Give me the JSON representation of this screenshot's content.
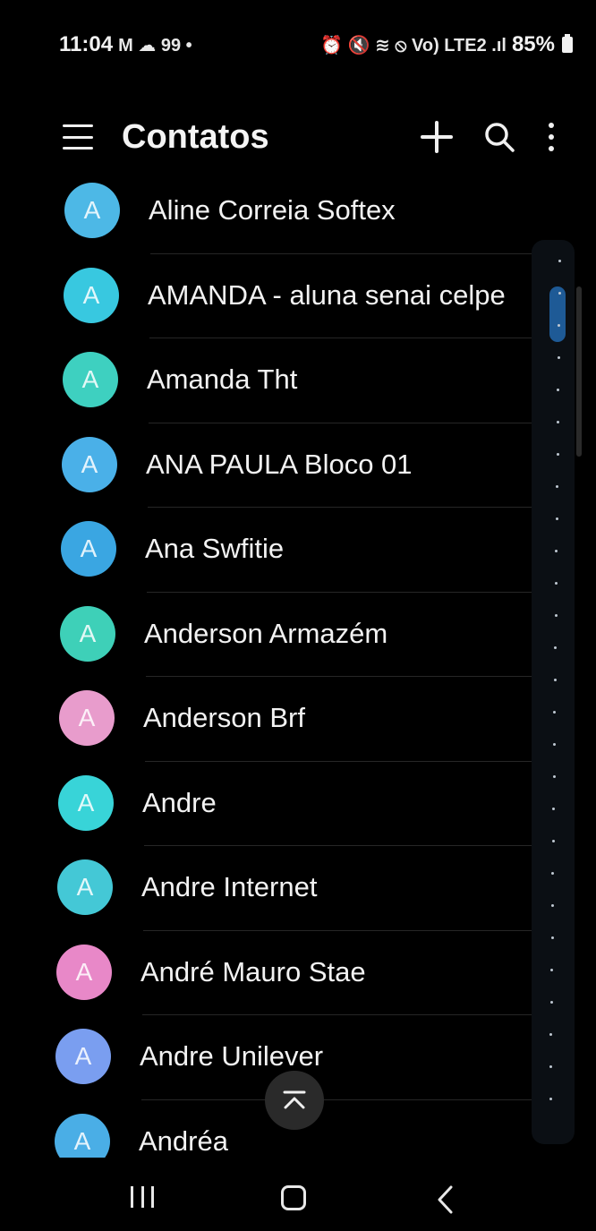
{
  "status_bar": {
    "time": "11:04",
    "left_icons": "M ☁ 99 •",
    "right_icons": "⏰ 🔇 ≋ ⦸ Vo) LTE2 .ıl",
    "battery": "85%"
  },
  "app_bar": {
    "title": "Contatos",
    "menu_icon": "hamburger-menu-icon",
    "add_icon": "plus-icon",
    "search_icon": "search-icon",
    "more_icon": "more-vertical-icon"
  },
  "contacts": [
    {
      "initial": "A",
      "name": "Aline Correia Softex",
      "color": "#4db8e6"
    },
    {
      "initial": "A",
      "name": "AMANDA - aluna senai celpe",
      "color": "#38c8e0"
    },
    {
      "initial": "A",
      "name": "Amanda Tht",
      "color": "#3ed0c0"
    },
    {
      "initial": "A",
      "name": "ANA PAULA Bloco 01",
      "color": "#4ab0e8"
    },
    {
      "initial": "A",
      "name": "Ana Swfitie",
      "color": "#3aa6e2"
    },
    {
      "initial": "A",
      "name": "Anderson Armazém",
      "color": "#3ed0b8"
    },
    {
      "initial": "A",
      "name": "Anderson Brf",
      "color": "#e89ccc"
    },
    {
      "initial": "A",
      "name": "Andre",
      "color": "#38d4d8"
    },
    {
      "initial": "A",
      "name": "Andre Internet",
      "color": "#44c8d6"
    },
    {
      "initial": "A",
      "name": "André Mauro Stae",
      "color": "#e888c8"
    },
    {
      "initial": "A",
      "name": "Andre Unilever",
      "color": "#7a9ef0"
    },
    {
      "initial": "A",
      "name": "Andréa",
      "color": "#4aaee6"
    }
  ],
  "colors": {
    "background": "#000000",
    "text": "#f2f2f2",
    "index_thumb": "#1e5a96"
  },
  "scroll_top_icon": "chevron-up-double-icon",
  "nav_bar": {
    "recent_icon": "recent-apps-icon",
    "home_icon": "home-icon",
    "back_icon": "back-icon"
  }
}
